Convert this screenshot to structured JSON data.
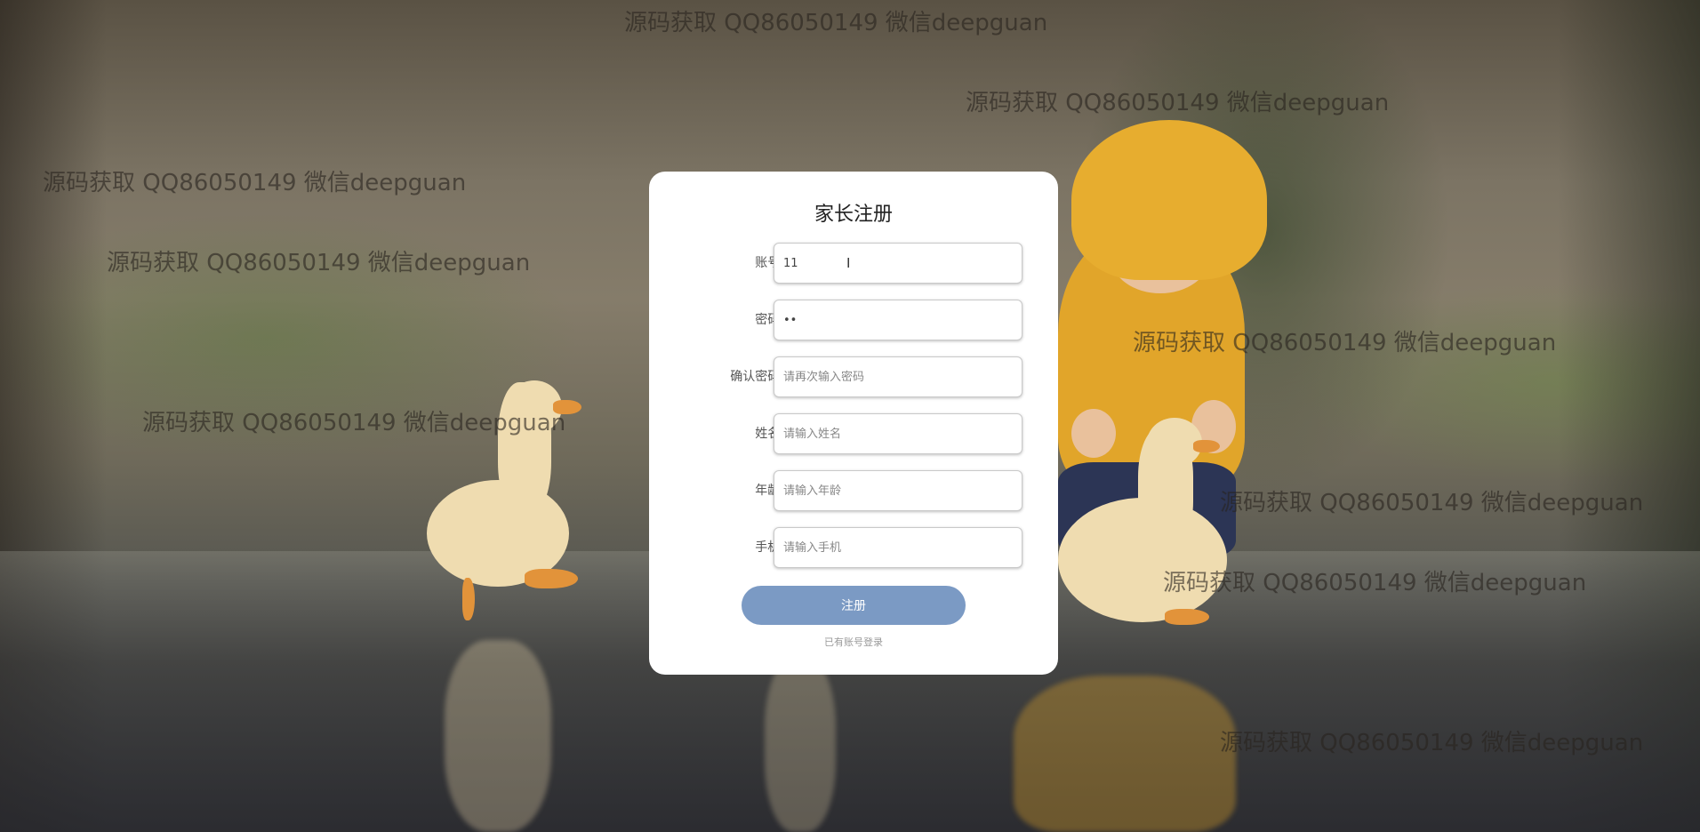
{
  "watermark_text": "源码获取 QQ86050149 微信deepguan",
  "form": {
    "title": "家长注册",
    "fields": [
      {
        "label": "账号:",
        "value": "11",
        "placeholder": ""
      },
      {
        "label": "密码:",
        "value": "••",
        "placeholder": ""
      },
      {
        "label": "确认密码:",
        "value": "",
        "placeholder": "请再次输入密码"
      },
      {
        "label": "姓名:",
        "value": "",
        "placeholder": "请输入姓名"
      },
      {
        "label": "年龄:",
        "value": "",
        "placeholder": "请输入年龄"
      },
      {
        "label": "手机:",
        "value": "",
        "placeholder": "请输入手机"
      }
    ],
    "submit_label": "注册",
    "login_link": "已有账号登录"
  },
  "colors": {
    "button": "#7b9ac4",
    "card": "#ffffff"
  },
  "icons": {
    "text_cursor": "text-cursor-icon"
  }
}
